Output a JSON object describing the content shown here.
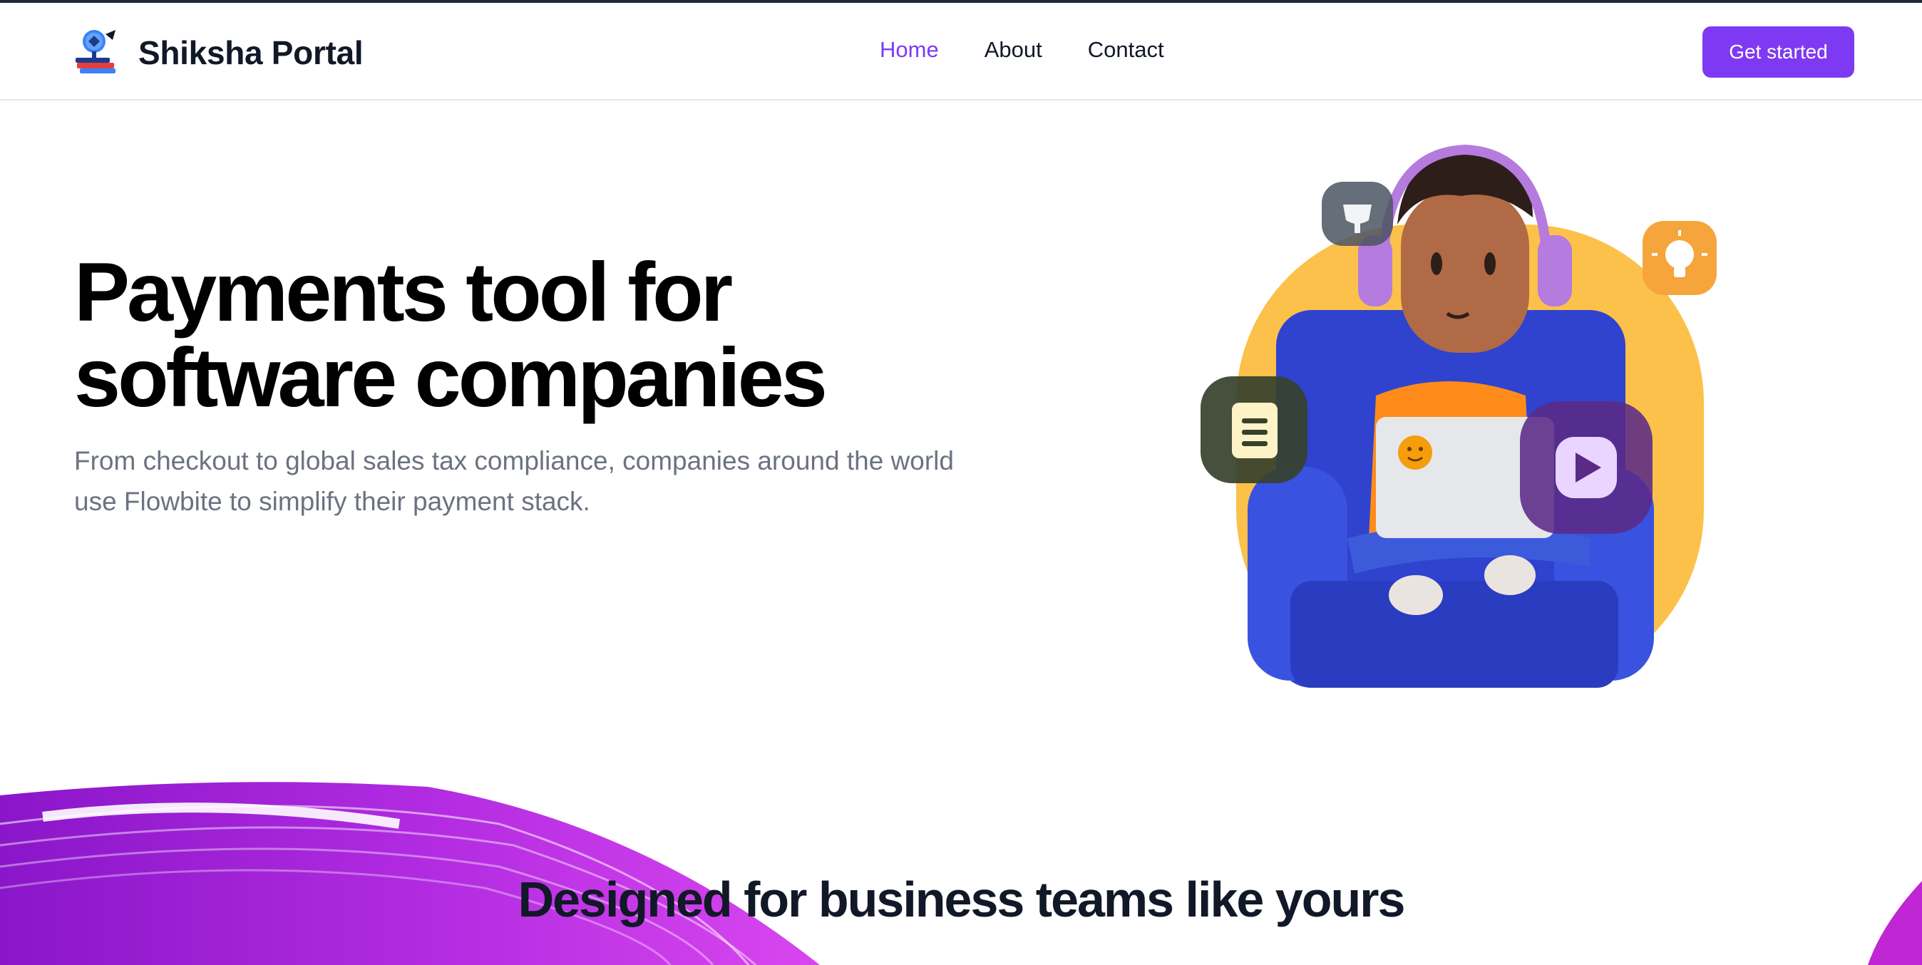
{
  "navbar": {
    "brand": "Shiksha Portal",
    "links": [
      {
        "label": "Home",
        "active": true
      },
      {
        "label": "About",
        "active": false
      },
      {
        "label": "Contact",
        "active": false
      }
    ],
    "cta_label": "Get started"
  },
  "hero": {
    "title_line1": "Payments tool for",
    "title_line2": "software companies",
    "subtitle_line1": "From checkout to global sales tax compliance, companies around the world",
    "subtitle_line2": "use Flowbite to simplify their payment stack."
  },
  "section": {
    "title": "Designed for business teams like yours"
  },
  "colors": {
    "accent": "#7e3af2",
    "muted_text": "#6b7280",
    "illustration_blob": "#fcc14a",
    "wave": "#9b1fd6"
  },
  "icons": [
    "logo-icon",
    "notepad-icon",
    "trophy-icon",
    "lightbulb-icon",
    "play-icon"
  ]
}
